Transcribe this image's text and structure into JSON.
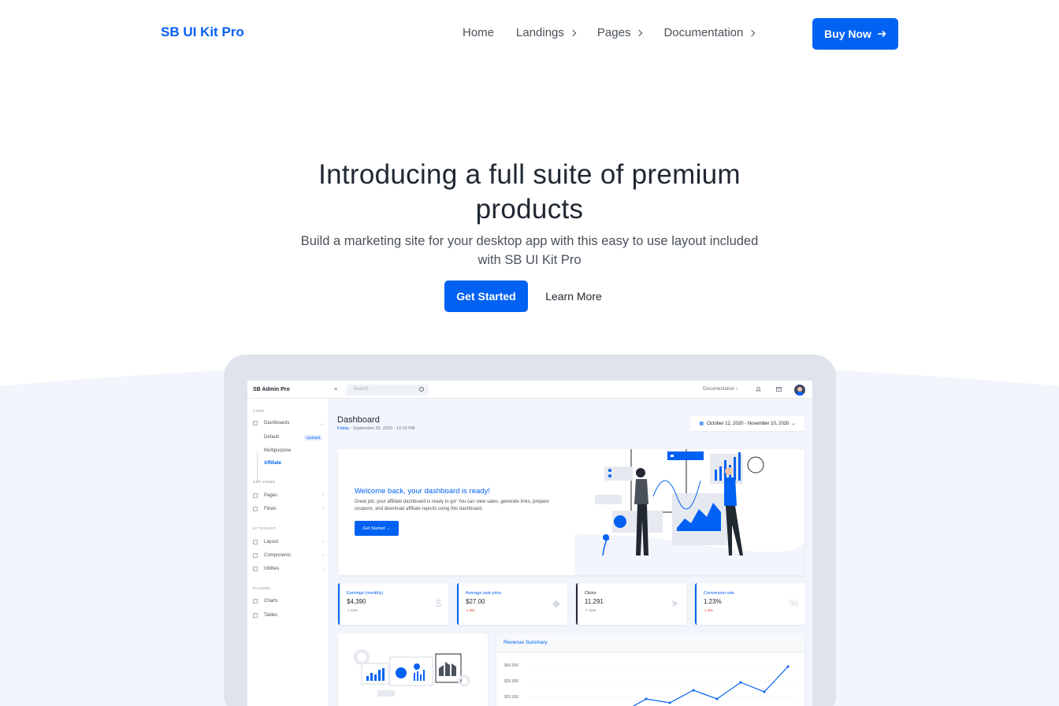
{
  "nav": {
    "brand": "SB UI Kit Pro",
    "links": [
      "Home",
      "Landings",
      "Pages",
      "Documentation"
    ],
    "buy_label": "Buy Now"
  },
  "hero": {
    "title": "Introducing a full suite of premium products",
    "subtitle": "Build a marketing site for your desktop app with this easy to use layout included with SB UI Kit Pro",
    "primary_label": "Get Started",
    "secondary_label": "Learn More"
  },
  "preview": {
    "app_title": "SB Admin Pro",
    "search_placeholder": "Search",
    "doc_link": "Documentation",
    "sidenav": {
      "core": "CORE",
      "dashboards": "Dashboards",
      "sub": [
        "Default",
        "Multipurpose",
        "Affiliate"
      ],
      "badge": "Updated",
      "app_views": "APP VIEWS",
      "pages": "Pages",
      "flows": "Flows",
      "ui_toolkit": "UI TOOLKIT",
      "layout": "Layout",
      "components": "Components",
      "utilities": "Utilities",
      "plugins": "PLUGINS",
      "charts": "Charts",
      "tables": "Tables"
    },
    "page_title": "Dashboard",
    "page_day": "Friday",
    "page_date": " · September 20, 2020 · 12:16 PM",
    "date_range": "October 12, 2020 - November 10, 2020",
    "welcome": {
      "title": "Welcome back, your dashboard is ready!",
      "text": "Great job, your affiliate dashboard is ready to go! You can view sales, generate links, prepare coupons, and download affiliate reports using this dashboard.",
      "button": "Get Started →"
    },
    "stats": [
      {
        "label": "Earnings (monthly)",
        "value": "$4,390",
        "trend": "12%",
        "dir": "up",
        "icon": "$"
      },
      {
        "label": "Average sale price",
        "value": "$27.00",
        "trend": "3%",
        "dir": "down",
        "icon": "◆"
      },
      {
        "label": "Clicks",
        "value": "11,291",
        "trend": "12%",
        "dir": "up",
        "icon": "➤"
      },
      {
        "label": "Conversion rate",
        "value": "1.23%",
        "trend": "1%",
        "dir": "down",
        "icon": "%"
      }
    ],
    "revenue": {
      "title": "Revenue Summary",
      "ticks": [
        "$40,000",
        "$30,000",
        "$20,000"
      ]
    },
    "colors": {
      "primary": "#0061f2",
      "down": "#e81500",
      "frame": "#dfe3eb"
    }
  }
}
